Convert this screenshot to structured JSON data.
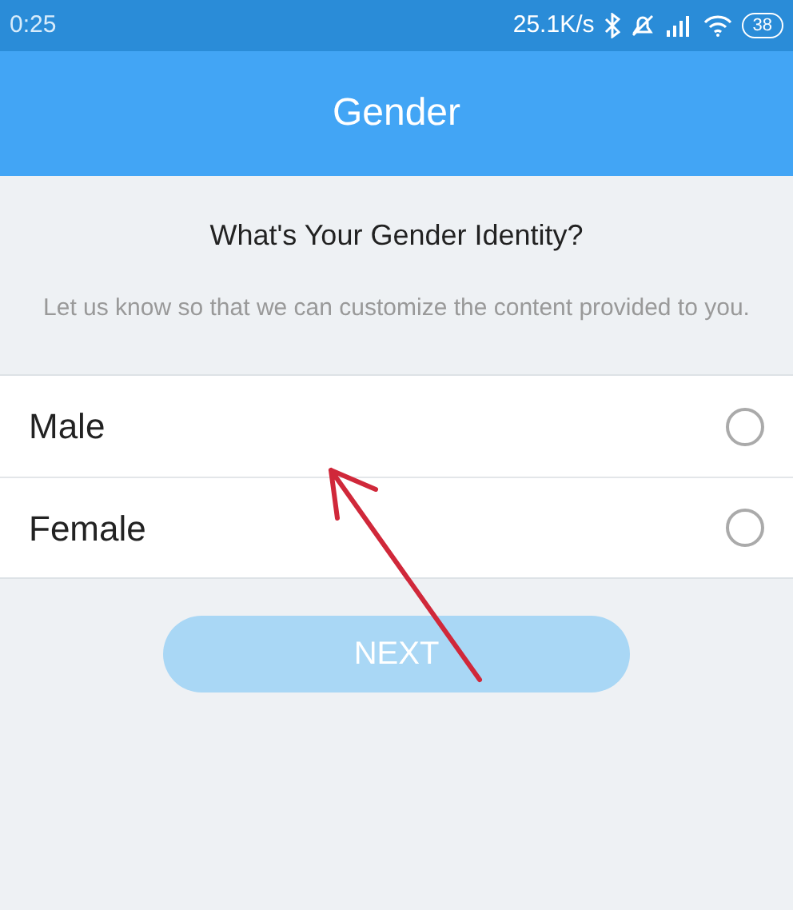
{
  "status_bar": {
    "time": "0:25",
    "speed": "25.1K/s",
    "battery": "38"
  },
  "header": {
    "title": "Gender"
  },
  "question": "What's Your Gender Identity?",
  "description": "Let us know so that we can customize the content provided to you.",
  "options": [
    {
      "label": "Male",
      "selected": false
    },
    {
      "label": "Female",
      "selected": false
    }
  ],
  "next_button": {
    "label": "NEXT",
    "disabled": true
  }
}
